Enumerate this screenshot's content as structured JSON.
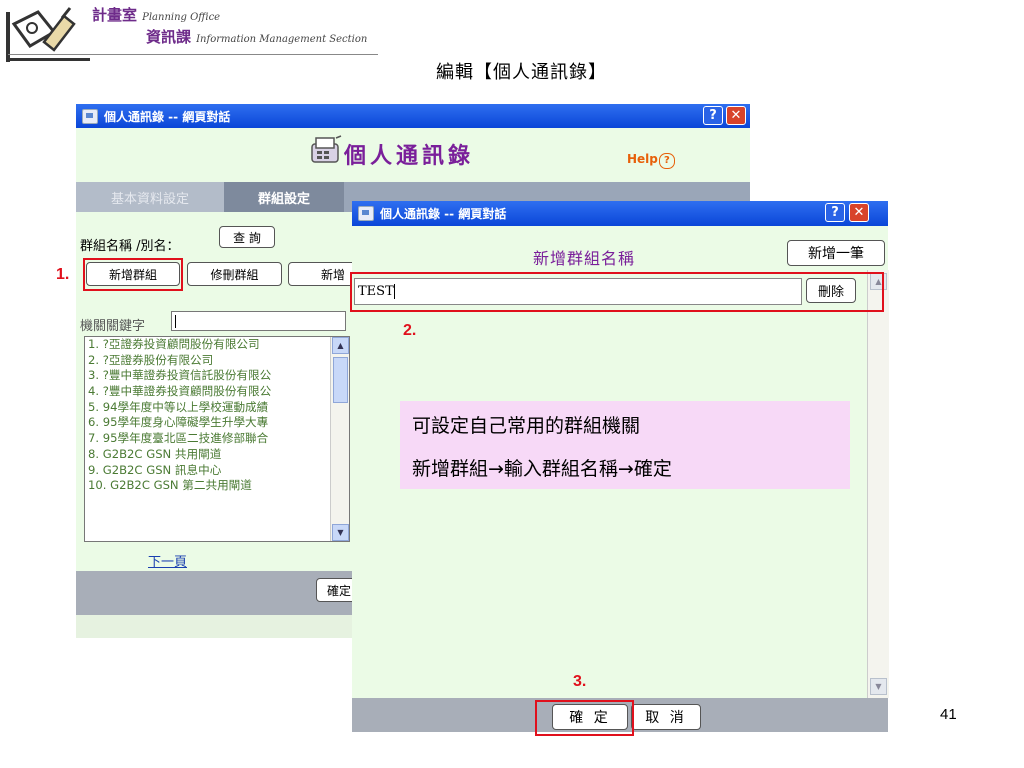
{
  "header": {
    "org_cn_1": "計畫室",
    "org_en_1": "Planning Office",
    "org_cn_2": "資訊課",
    "org_en_2": "Information Management Section"
  },
  "slide_title": "編輯【個人通訊錄】",
  "page_number": "41",
  "window1": {
    "title": "個人通訊錄 -- 網頁對話",
    "app_title": "個人通訊錄",
    "help": "Help",
    "tabs": [
      "基本資料設定",
      "群組設定"
    ],
    "group_name_label": "群組名稱 /別名：",
    "query_button": "查 詢",
    "add_group_button": "新增群組",
    "edit_group_button": "修刪群組",
    "new_button_partial": "新增",
    "keyword_label": "機關關鍵字",
    "org_list": [
      "1. ?亞證券投資顧問股份有限公司",
      "2. ?亞證券股份有限公司",
      "3. ?豐中華證券投資信託股份有限公",
      "4. ?豐中華證券投資顧問股份有限公",
      "5. 94學年度中等以上學校運動成績",
      "6. 95學年度身心障礙學生升學大專",
      "7. 95學年度臺北區二技進修部聯合",
      "8. G2B2C GSN 共用閘道",
      "9. G2B2C GSN 訊息中心",
      "10. G2B2C GSN 第二共用閘道"
    ],
    "next_page": "下一頁",
    "confirm_partial": "確定"
  },
  "window2": {
    "title": "個人通訊錄 -- 網頁對話",
    "heading": "新增群組名稱",
    "add_one_button": "新增一筆",
    "name_value": "TEST",
    "delete_button": "刪除",
    "ok_button": "確 定",
    "cancel_button": "取 消"
  },
  "steps": [
    "1.",
    "2.",
    "3."
  ],
  "annotation": {
    "line1": "可設定自己常用的群組機關",
    "line2": "新增群組→輸入群組名稱→確定"
  },
  "colors": {
    "titlebar": "#0a46d8",
    "panel_bg": "#ebfbe6",
    "highlight_red": "#e0101c",
    "annotation_bg": "#f7d9f7",
    "app_title": "#7a1f9a"
  }
}
